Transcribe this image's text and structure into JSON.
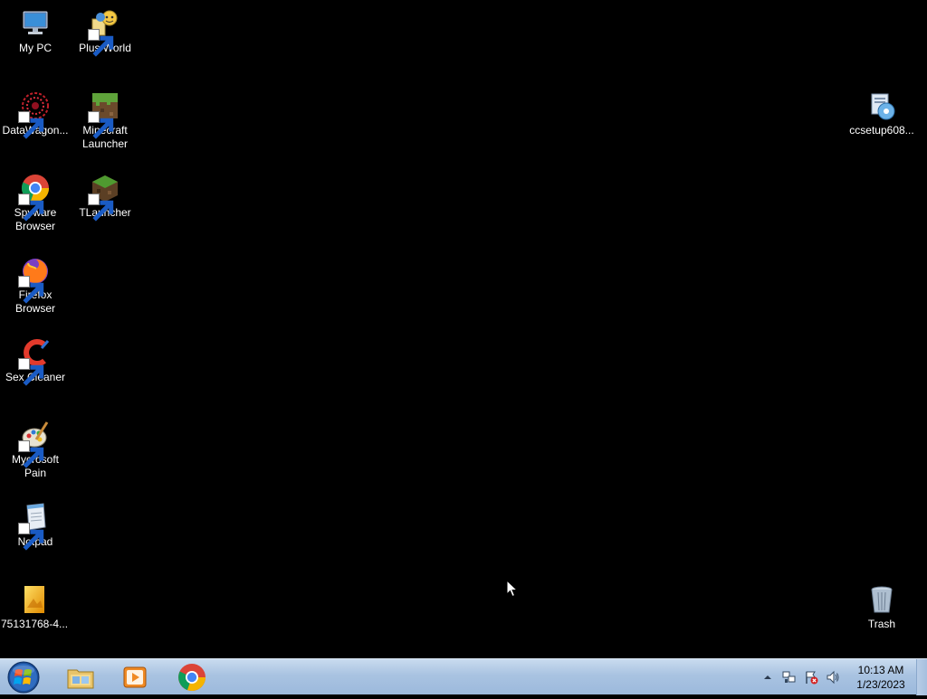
{
  "desktop": {
    "icons": [
      {
        "label": "My PC",
        "icon": "computer-icon"
      },
      {
        "label": "Plus World",
        "icon": "plus-world-icon"
      },
      {
        "label": "DataWagon...",
        "icon": "datawagon-icon"
      },
      {
        "label": "Minecraft Launcher",
        "icon": "minecraft-icon"
      },
      {
        "label": "ccsetup608...",
        "icon": "installer-icon"
      },
      {
        "label": "Spyware Browser",
        "icon": "chrome-icon"
      },
      {
        "label": "TLauncher",
        "icon": "tlauncher-icon"
      },
      {
        "label": "Firefox Browser",
        "icon": "firefox-icon"
      },
      {
        "label": "Sex Cleaner",
        "icon": "ccleaner-icon"
      },
      {
        "label": "Mycrosoft Pain",
        "icon": "paint-icon"
      },
      {
        "label": "Notpad",
        "icon": "notepad-icon"
      },
      {
        "label": "75131768-4...",
        "icon": "image-file-icon"
      },
      {
        "label": "Trash",
        "icon": "recycle-bin-icon"
      }
    ]
  },
  "taskbar": {
    "start": "start-orb-icon",
    "pinned": [
      "file-explorer-icon",
      "media-player-icon",
      "chrome-icon"
    ],
    "tray": [
      "show-hidden-icons-arrow",
      "network-icon",
      "action-center-icon",
      "volume-icon"
    ],
    "clock_time": "10:13 AM",
    "clock_date": "1/23/2023"
  }
}
